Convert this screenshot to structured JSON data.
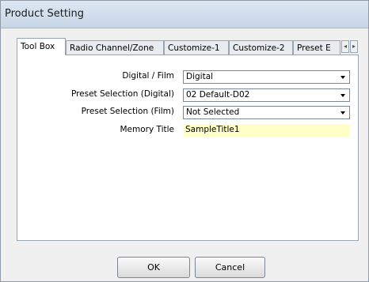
{
  "window": {
    "title": "Product Setting"
  },
  "tabs": [
    {
      "label": "Tool Box"
    },
    {
      "label": "Radio Channel/Zone"
    },
    {
      "label": "Customize-1"
    },
    {
      "label": "Customize-2"
    },
    {
      "label": "Preset E"
    }
  ],
  "tab_scroll": {
    "left": "◂",
    "right": "▸"
  },
  "form": {
    "digital_film": {
      "label": "Digital / Film",
      "value": "Digital"
    },
    "preset_digital": {
      "label": "Preset Selection (Digital)",
      "value": "02 Default-D02"
    },
    "preset_film": {
      "label": "Preset Selection (Film)",
      "value": "Not Selected"
    },
    "memory_title": {
      "label": "Memory Title",
      "value": "SampleTitle1"
    }
  },
  "buttons": {
    "ok": "OK",
    "cancel": "Cancel"
  }
}
